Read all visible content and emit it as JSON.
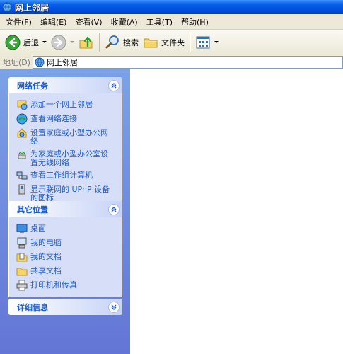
{
  "window": {
    "title": "网上邻居"
  },
  "menu": [
    {
      "label": "文件(F)"
    },
    {
      "label": "编辑(E)"
    },
    {
      "label": "查看(V)"
    },
    {
      "label": "收藏(A)"
    },
    {
      "label": "工具(T)"
    },
    {
      "label": "帮助(H)"
    }
  ],
  "toolbar": {
    "back_label": "后退",
    "search_label": "搜索",
    "folders_label": "文件夹"
  },
  "address": {
    "label": "地址(D)",
    "value": "网上邻居"
  },
  "task_pane": {
    "network_tasks": {
      "title": "网络任务",
      "items": [
        {
          "label": "添加一个网上邻居",
          "icon": "add-network-place-icon"
        },
        {
          "label": "查看网络连接",
          "icon": "network-connections-icon"
        },
        {
          "label": "设置家庭或小型办公网络",
          "icon": "setup-network-icon"
        },
        {
          "label": "为家庭或小型办公室设置无线网络",
          "icon": "wireless-network-icon"
        },
        {
          "label": "查看工作组计算机",
          "icon": "workgroup-computers-icon"
        },
        {
          "label": "显示联网的 UPnP 设备的图标",
          "icon": "upnp-device-icon"
        }
      ]
    },
    "other_places": {
      "title": "其它位置",
      "items": [
        {
          "label": "桌面",
          "icon": "desktop-icon"
        },
        {
          "label": "我的电脑",
          "icon": "my-computer-icon"
        },
        {
          "label": "我的文档",
          "icon": "my-documents-icon"
        },
        {
          "label": "共享文档",
          "icon": "shared-documents-icon"
        },
        {
          "label": "打印机和传真",
          "icon": "printers-faxes-icon"
        }
      ]
    },
    "details": {
      "title": "详细信息"
    }
  },
  "colors": {
    "titlebar": "#0054e3",
    "taskpane_bg": "#6f8ee0",
    "link": "#215dc6"
  }
}
